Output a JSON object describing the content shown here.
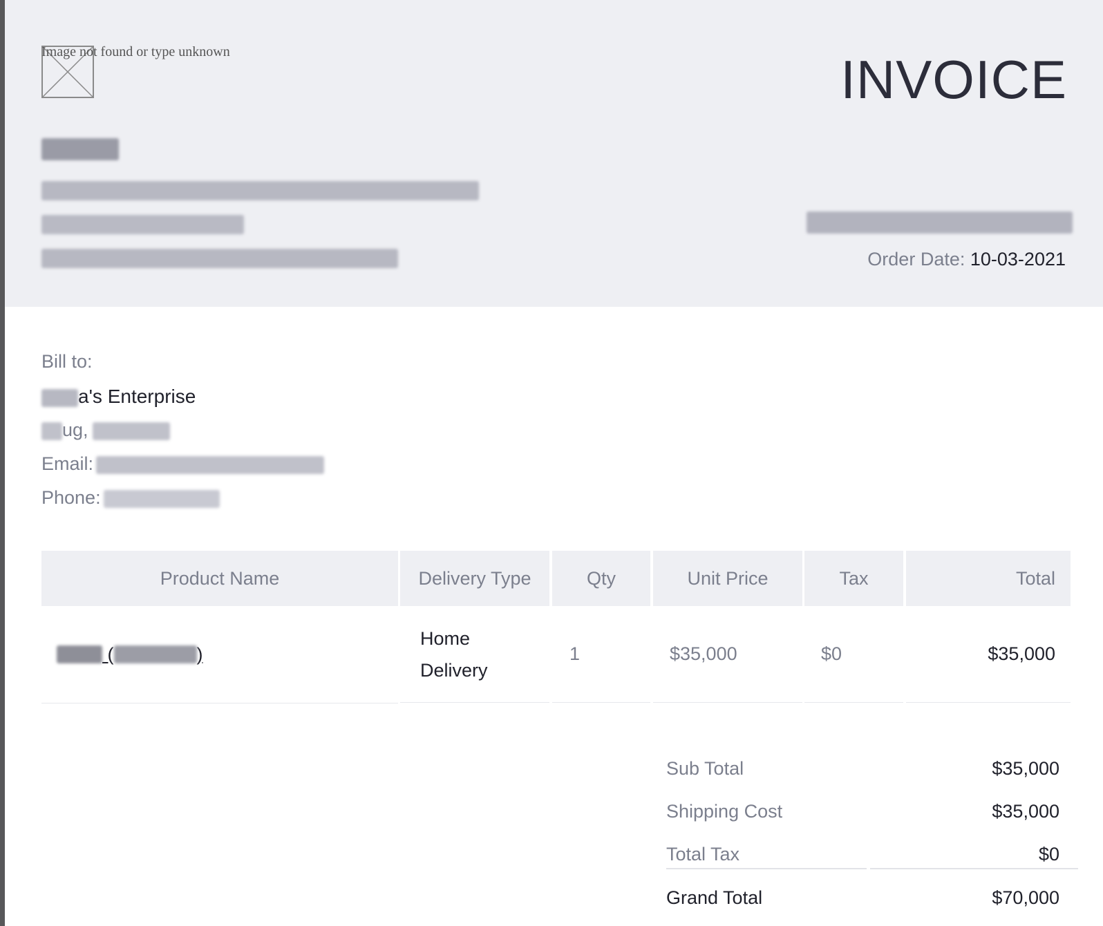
{
  "header": {
    "logo_alt": "Image not found or type unknown",
    "title": "INVOICE",
    "order_date_label": "Order Date:",
    "order_date_value": "10-03-2021"
  },
  "bill_to": {
    "label": "Bill to:",
    "name_suffix": "a's Enterprise",
    "city_visible": "ug,",
    "email_label": "Email:",
    "phone_label": "Phone:"
  },
  "table": {
    "headers": [
      "Product Name",
      "Delivery Type",
      "Qty",
      "Unit Price",
      "Tax",
      "Total"
    ],
    "rows": [
      {
        "delivery_type": "Home Delivery",
        "qty": "1",
        "unit_price": "$35,000",
        "tax": "$0",
        "total": "$35,000"
      }
    ]
  },
  "summary": {
    "sub_total_label": "Sub Total",
    "sub_total_value": "$35,000",
    "shipping_label": "Shipping Cost",
    "shipping_value": "$35,000",
    "tax_label": "Total Tax",
    "tax_value": "$0",
    "grand_total_label": "Grand Total",
    "grand_total_value": "$70,000"
  },
  "colors": {
    "header_bg": "#eeeff3",
    "text_dark": "#20212b",
    "text_muted": "#7b7f8d"
  }
}
